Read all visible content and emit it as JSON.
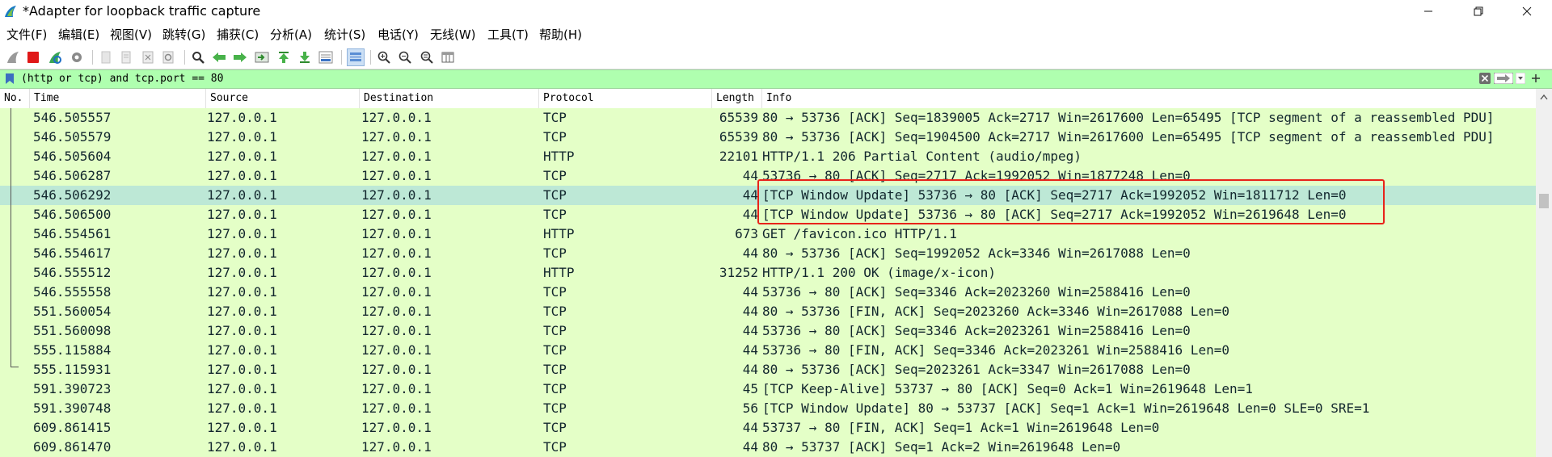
{
  "window": {
    "title": "*Adapter for loopback traffic capture",
    "icon": "wireshark-fin-icon",
    "controls": [
      "minimize-icon",
      "restore-icon",
      "close-icon"
    ]
  },
  "menu": [
    {
      "label": "文件(F)"
    },
    {
      "label": "编辑(E)"
    },
    {
      "label": "视图(V)"
    },
    {
      "label": "跳转(G)"
    },
    {
      "label": "捕获(C)"
    },
    {
      "label": "分析(A)"
    },
    {
      "label": "统计(S)"
    },
    {
      "label": "电话(Y)"
    },
    {
      "label": "无线(W)"
    },
    {
      "label": "工具(T)"
    },
    {
      "label": "帮助(H)"
    }
  ],
  "filter": {
    "value": "(http or tcp) and tcp.port == 80",
    "background": "#afffaf"
  },
  "columns": {
    "no": "No.",
    "time": "Time",
    "source": "Source",
    "destination": "Destination",
    "protocol": "Protocol",
    "length": "Length",
    "info": "Info"
  },
  "packets": [
    {
      "time": "546.505557",
      "source": "127.0.0.1",
      "destination": "127.0.0.1",
      "protocol": "TCP",
      "length": "65539",
      "info": "80 → 53736 [ACK] Seq=1839005 Ack=2717 Win=2617600 Len=65495 [TCP segment of a reassembled PDU]"
    },
    {
      "time": "546.505579",
      "source": "127.0.0.1",
      "destination": "127.0.0.1",
      "protocol": "TCP",
      "length": "65539",
      "info": "80 → 53736 [ACK] Seq=1904500 Ack=2717 Win=2617600 Len=65495 [TCP segment of a reassembled PDU]"
    },
    {
      "time": "546.505604",
      "source": "127.0.0.1",
      "destination": "127.0.0.1",
      "protocol": "HTTP",
      "length": "22101",
      "info": "HTTP/1.1 206 Partial Content  (audio/mpeg)"
    },
    {
      "time": "546.506287",
      "source": "127.0.0.1",
      "destination": "127.0.0.1",
      "protocol": "TCP",
      "length": "44",
      "info": "53736 → 80 [ACK] Seq=2717 Ack=1992052 Win=1877248 Len=0"
    },
    {
      "time": "546.506292",
      "source": "127.0.0.1",
      "destination": "127.0.0.1",
      "protocol": "TCP",
      "length": "44",
      "info": "[TCP Window Update] 53736 → 80 [ACK] Seq=2717 Ack=1992052 Win=1811712 Len=0",
      "selected": true
    },
    {
      "time": "546.506500",
      "source": "127.0.0.1",
      "destination": "127.0.0.1",
      "protocol": "TCP",
      "length": "44",
      "info": "[TCP Window Update] 53736 → 80 [ACK] Seq=2717 Ack=1992052 Win=2619648 Len=0"
    },
    {
      "time": "546.554561",
      "source": "127.0.0.1",
      "destination": "127.0.0.1",
      "protocol": "HTTP",
      "length": "673",
      "info": "GET /favicon.ico HTTP/1.1"
    },
    {
      "time": "546.554617",
      "source": "127.0.0.1",
      "destination": "127.0.0.1",
      "protocol": "TCP",
      "length": "44",
      "info": "80 → 53736 [ACK] Seq=1992052 Ack=3346 Win=2617088 Len=0"
    },
    {
      "time": "546.555512",
      "source": "127.0.0.1",
      "destination": "127.0.0.1",
      "protocol": "HTTP",
      "length": "31252",
      "info": "HTTP/1.1 200 OK  (image/x-icon)"
    },
    {
      "time": "546.555558",
      "source": "127.0.0.1",
      "destination": "127.0.0.1",
      "protocol": "TCP",
      "length": "44",
      "info": "53736 → 80 [ACK] Seq=3346 Ack=2023260 Win=2588416 Len=0"
    },
    {
      "time": "551.560054",
      "source": "127.0.0.1",
      "destination": "127.0.0.1",
      "protocol": "TCP",
      "length": "44",
      "info": "80 → 53736 [FIN, ACK] Seq=2023260 Ack=3346 Win=2617088 Len=0"
    },
    {
      "time": "551.560098",
      "source": "127.0.0.1",
      "destination": "127.0.0.1",
      "protocol": "TCP",
      "length": "44",
      "info": "53736 → 80 [ACK] Seq=3346 Ack=2023261 Win=2588416 Len=0"
    },
    {
      "time": "555.115884",
      "source": "127.0.0.1",
      "destination": "127.0.0.1",
      "protocol": "TCP",
      "length": "44",
      "info": "53736 → 80 [FIN, ACK] Seq=3346 Ack=2023261 Win=2588416 Len=0"
    },
    {
      "time": "555.115931",
      "source": "127.0.0.1",
      "destination": "127.0.0.1",
      "protocol": "TCP",
      "length": "44",
      "info": "80 → 53736 [ACK] Seq=2023261 Ack=3347 Win=2617088 Len=0"
    },
    {
      "time": "591.390723",
      "source": "127.0.0.1",
      "destination": "127.0.0.1",
      "protocol": "TCP",
      "length": "45",
      "info": "[TCP Keep-Alive] 53737 → 80 [ACK] Seq=0 Ack=1 Win=2619648 Len=1"
    },
    {
      "time": "591.390748",
      "source": "127.0.0.1",
      "destination": "127.0.0.1",
      "protocol": "TCP",
      "length": "56",
      "info": "[TCP Window Update] 80 → 53737 [ACK] Seq=1 Ack=1 Win=2619648 Len=0 SLE=0 SRE=1"
    },
    {
      "time": "609.861415",
      "source": "127.0.0.1",
      "destination": "127.0.0.1",
      "protocol": "TCP",
      "length": "44",
      "info": "53737 → 80 [FIN, ACK] Seq=1 Ack=1 Win=2619648 Len=0"
    },
    {
      "time": "609.861470",
      "source": "127.0.0.1",
      "destination": "127.0.0.1",
      "protocol": "TCP",
      "length": "44",
      "info": "80 → 53737 [ACK] Seq=1 Ack=2 Win=2619648 Len=0"
    }
  ],
  "colors": {
    "row_background": "#e4ffc7",
    "selected_row": "#bde8d6",
    "row_text": "#12272e",
    "annotation_box": "#e8231a"
  }
}
